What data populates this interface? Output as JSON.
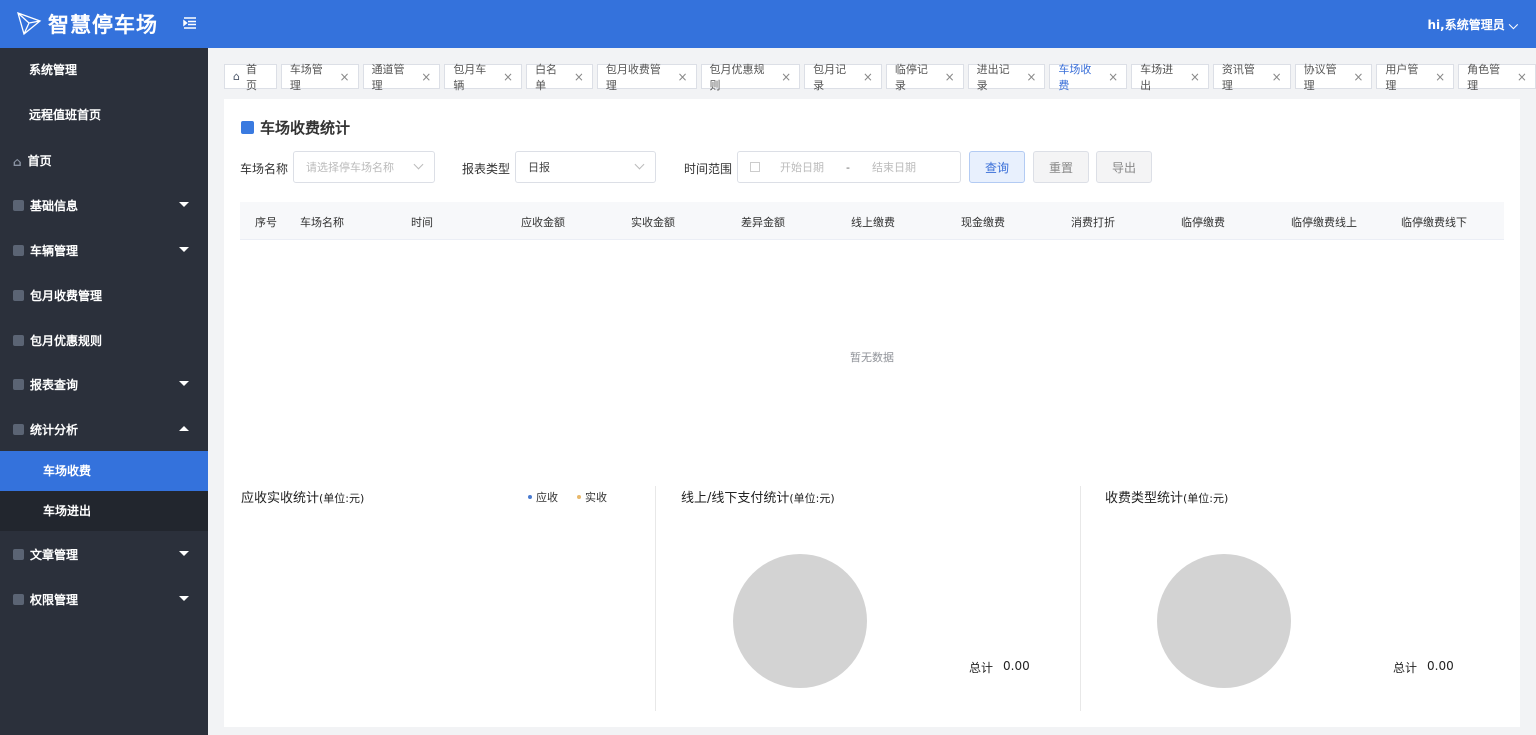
{
  "header": {
    "brand": "智慧停车场",
    "user": "hi,系统管理员"
  },
  "sidebar": {
    "top_items": [
      "系统管理",
      "远程值班首页"
    ],
    "items": [
      {
        "label": "首页",
        "icon": "home-icon"
      },
      {
        "label": "基础信息",
        "icon": "list-icon",
        "expandable": true
      },
      {
        "label": "车辆管理",
        "icon": "car-icon",
        "expandable": true
      },
      {
        "label": "包月收费管理",
        "icon": "fee-icon"
      },
      {
        "label": "包月优惠规则",
        "icon": "month-icon"
      },
      {
        "label": "报表查询",
        "icon": "report-icon",
        "expandable": true
      },
      {
        "label": "统计分析",
        "icon": "chart-icon",
        "expandable": true,
        "expanded": true
      },
      {
        "label": "文章管理",
        "icon": "article-icon",
        "expandable": true
      },
      {
        "label": "权限管理",
        "icon": "lock-icon",
        "expandable": true
      }
    ],
    "sub_items": [
      {
        "label": "车场收费",
        "active": true
      },
      {
        "label": "车场进出"
      }
    ]
  },
  "tabs": [
    {
      "label": "首页",
      "closable": false
    },
    {
      "label": "车场管理"
    },
    {
      "label": "通道管理"
    },
    {
      "label": "包月车辆"
    },
    {
      "label": "白名单"
    },
    {
      "label": "包月收费管理"
    },
    {
      "label": "包月优惠规则"
    },
    {
      "label": "包月记录"
    },
    {
      "label": "临停记录"
    },
    {
      "label": "进出记录"
    },
    {
      "label": "车场收费",
      "active": true
    },
    {
      "label": "车场进出"
    },
    {
      "label": "资讯管理"
    },
    {
      "label": "协议管理"
    },
    {
      "label": "用户管理"
    },
    {
      "label": "角色管理"
    }
  ],
  "page": {
    "title": "车场收费统计"
  },
  "filters": {
    "lot_label": "车场名称",
    "lot_placeholder": "请选择停车场名称",
    "type_label": "报表类型",
    "type_value": "日报",
    "range_label": "时间范围",
    "start_placeholder": "开始日期",
    "sep": "-",
    "end_placeholder": "结束日期",
    "query": "查询",
    "reset": "重置",
    "export": "导出"
  },
  "table": {
    "columns": [
      "序号",
      "车场名称",
      "时间",
      "应收金额",
      "实收金额",
      "差异金额",
      "线上缴费",
      "现金缴费",
      "消费打折",
      "临停缴费",
      "临停缴费线上",
      "临停缴费线下"
    ],
    "empty": "暂无数据"
  },
  "charts": [
    {
      "title": "应收实收统计",
      "unit": "(单位:元)",
      "legend": [
        {
          "name": "应收",
          "color": "#4a7bd0"
        },
        {
          "name": "实收",
          "color": "#e8b86a"
        }
      ]
    },
    {
      "title": "线上/线下支付统计",
      "unit": "(单位:元)",
      "total_label": "总计",
      "total": "0.00"
    },
    {
      "title": "收费类型统计",
      "unit": "(单位:元)",
      "total_label": "总计",
      "total": "0.00"
    }
  ]
}
